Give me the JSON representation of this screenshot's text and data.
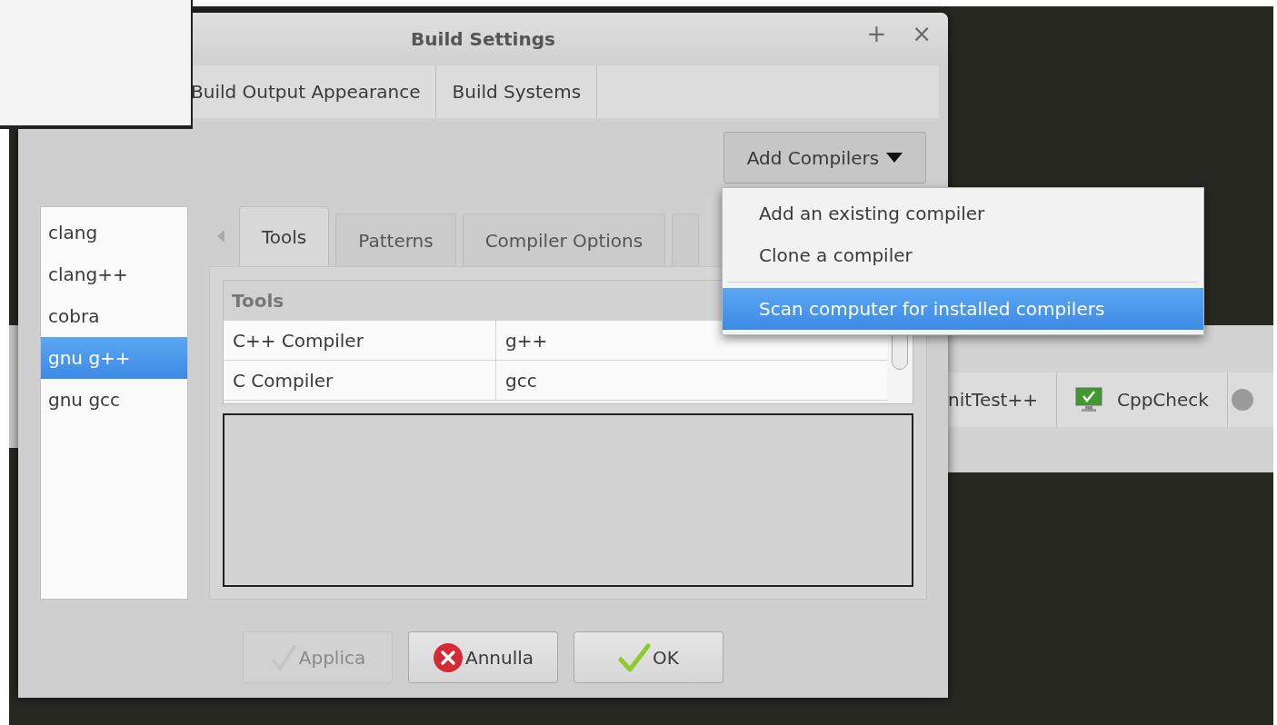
{
  "dialog": {
    "title": "Build Settings",
    "title_buttons": [
      "+",
      "×"
    ]
  },
  "tabs": [
    {
      "label": "Build Output Appearance",
      "selected": false
    },
    {
      "label": "Build Systems",
      "selected": false
    }
  ],
  "add_compilers": {
    "label": "Add Compilers",
    "expanded": true
  },
  "menu": {
    "items": [
      {
        "kind": "item",
        "label": "Add an existing compiler",
        "selected": false
      },
      {
        "kind": "item",
        "label": "Clone a compiler",
        "selected": false
      },
      {
        "kind": "separator"
      },
      {
        "kind": "item",
        "label": "Scan computer for installed compilers",
        "selected": true
      }
    ]
  },
  "compilers": [
    {
      "name": "clang",
      "selected": false
    },
    {
      "name": "clang++",
      "selected": false
    },
    {
      "name": "cobra",
      "selected": false
    },
    {
      "name": "gnu g++",
      "selected": true
    },
    {
      "name": "gnu gcc",
      "selected": false
    }
  ],
  "inner_tabs": [
    {
      "label": "Tools",
      "selected": true
    },
    {
      "label": "Patterns",
      "selected": false
    },
    {
      "label": "Compiler Options",
      "selected": false
    }
  ],
  "tools_table": {
    "header": "Tools",
    "rows": [
      [
        "C++ Compiler",
        "g++"
      ],
      [
        "C Compiler",
        "gcc"
      ]
    ]
  },
  "buttons": [
    {
      "kind": "apply",
      "label": "Applica",
      "disabled": true
    },
    {
      "kind": "cancel",
      "label": "Annulla",
      "disabled": false
    },
    {
      "kind": "ok",
      "label": "OK",
      "disabled": false
    }
  ],
  "background_toolbar": {
    "tabs": [
      {
        "kind": "text",
        "label": "nitTest++"
      },
      {
        "kind": "icon",
        "label": "CppCheck"
      }
    ]
  }
}
